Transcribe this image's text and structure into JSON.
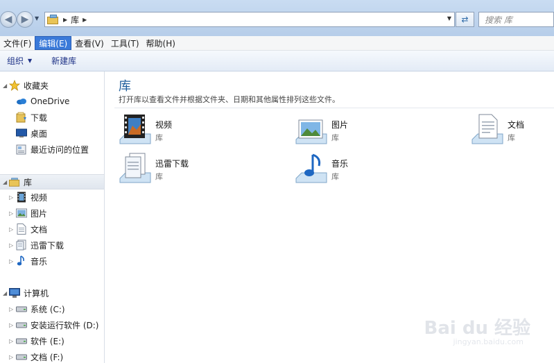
{
  "address": {
    "path": "库",
    "search_placeholder": "搜索 库"
  },
  "menu": [
    {
      "label": "文件(F)"
    },
    {
      "label": "编辑(E)"
    },
    {
      "label": "查看(V)"
    },
    {
      "label": "工具(T)"
    },
    {
      "label": "帮助(H)"
    }
  ],
  "toolbar": {
    "organize": "组织",
    "new_library": "新建库"
  },
  "nav": {
    "favorites": {
      "label": "收藏夹",
      "items": [
        {
          "label": "OneDrive",
          "icon": "onedrive-icon"
        },
        {
          "label": "下载",
          "icon": "download-folder-icon"
        },
        {
          "label": "桌面",
          "icon": "desktop-icon"
        },
        {
          "label": "最近访问的位置",
          "icon": "recent-places-icon"
        }
      ]
    },
    "libraries": {
      "label": "库",
      "items": [
        {
          "label": "视频",
          "icon": "video-icon"
        },
        {
          "label": "图片",
          "icon": "pictures-icon"
        },
        {
          "label": "文档",
          "icon": "documents-icon"
        },
        {
          "label": "迅雷下载",
          "icon": "thunder-download-icon"
        },
        {
          "label": "音乐",
          "icon": "music-icon"
        }
      ]
    },
    "computer": {
      "label": "计算机",
      "items": [
        {
          "label": "系统 (C:)",
          "icon": "drive-icon"
        },
        {
          "label": "安装运行软件 (D:)",
          "icon": "drive-icon"
        },
        {
          "label": "软件 (E:)",
          "icon": "drive-icon"
        },
        {
          "label": "文档 (F:)",
          "icon": "drive-icon"
        }
      ]
    }
  },
  "content": {
    "title": "库",
    "subtitle": "打开库以查看文件并根据文件夹、日期和其他属性排列这些文件。",
    "libraries": [
      {
        "name": "视频",
        "type": "库",
        "icon": "video-library-icon"
      },
      {
        "name": "图片",
        "type": "库",
        "icon": "pictures-library-icon"
      },
      {
        "name": "文档",
        "type": "库",
        "icon": "documents-library-icon"
      },
      {
        "name": "迅雷下载",
        "type": "库",
        "icon": "download-library-icon"
      },
      {
        "name": "音乐",
        "type": "库",
        "icon": "music-library-icon"
      }
    ]
  },
  "watermark": {
    "brand": "Bai du 经验",
    "url": "jingyan.baidu.com"
  }
}
